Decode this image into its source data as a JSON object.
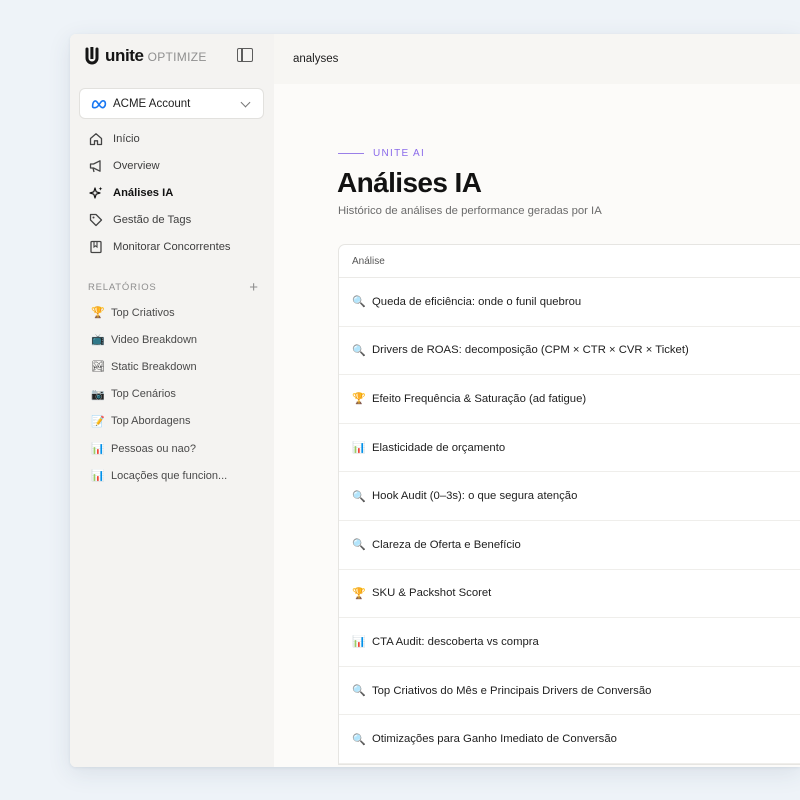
{
  "brand": {
    "name": "unite",
    "sub": "OPTIMIZE"
  },
  "topbar": {
    "title": "analyses"
  },
  "account": {
    "name": "ACME Account"
  },
  "nav": [
    {
      "label": "Início",
      "icon": "home-icon"
    },
    {
      "label": "Overview",
      "icon": "megaphone-icon"
    },
    {
      "label": "Análises IA",
      "icon": "sparkles-icon",
      "active": true
    },
    {
      "label": "Gestão de Tags",
      "icon": "tag-icon"
    },
    {
      "label": "Monitorar Concorrentes",
      "icon": "book-icon"
    }
  ],
  "reports_section": {
    "title": "RELATÓRIOS",
    "add": "+"
  },
  "reports": [
    {
      "emoji": "🏆",
      "label": "Top Criativos"
    },
    {
      "emoji": "📺",
      "label": "Video Breakdown"
    },
    {
      "emoji": "🏞",
      "label": "Static Breakdown"
    },
    {
      "emoji": "📷",
      "label": "Top Cenários"
    },
    {
      "emoji": "📝",
      "label": "Top Abordagens"
    },
    {
      "emoji": "📊",
      "label": "Pessoas ou nao?"
    },
    {
      "emoji": "📊",
      "label": "Locações que funcion..."
    }
  ],
  "header": {
    "eyebrow": "UNITE AI",
    "title": "Análises IA",
    "subtitle": "Histórico de análises de performance geradas por IA"
  },
  "table": {
    "column": "Análise",
    "rows": [
      {
        "emoji": "🔍",
        "title": "Queda de eficiência: onde o funil quebrou"
      },
      {
        "emoji": "🔍",
        "title": "Drivers de ROAS: decomposição (CPM × CTR × CVR × Ticket)"
      },
      {
        "emoji": "🏆",
        "title": "Efeito Frequência & Saturação (ad fatigue)"
      },
      {
        "emoji": "📊",
        "title": "Elasticidade de orçamento"
      },
      {
        "emoji": "🔍",
        "title": "Hook Audit (0–3s): o que segura atenção"
      },
      {
        "emoji": "🔍",
        "title": "Clareza de Oferta e Benefício"
      },
      {
        "emoji": "🏆",
        "title": "SKU & Packshot Scoret"
      },
      {
        "emoji": "📊",
        "title": "CTA Audit: descoberta vs compra"
      },
      {
        "emoji": "🔍",
        "title": "Top Criativos do Mês e Principais Drivers de Conversão"
      },
      {
        "emoji": "🔍",
        "title": "Otimizações para Ganho Imediato de Conversão"
      }
    ]
  },
  "colors": {
    "accent": "#8b6bea",
    "meta": "#1877f2"
  }
}
